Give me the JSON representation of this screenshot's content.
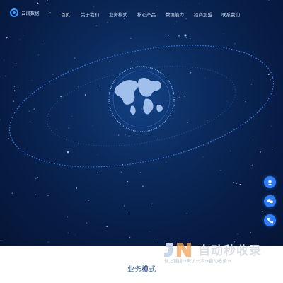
{
  "brand": {
    "name": "云阔数据"
  },
  "nav": {
    "items": [
      {
        "label": "首页",
        "active": true
      },
      {
        "label": "关于我们",
        "active": false
      },
      {
        "label": "业务模式",
        "active": false
      },
      {
        "label": "核心产品",
        "active": false
      },
      {
        "label": "数据能力",
        "active": false
      },
      {
        "label": "招商加盟",
        "active": false
      },
      {
        "label": "联系我们",
        "active": false
      }
    ]
  },
  "side_tools": [
    {
      "icon": "customer-service-icon"
    },
    {
      "icon": "wechat-icon"
    },
    {
      "icon": "phone-icon"
    }
  ],
  "section": {
    "title": "业务模式"
  },
  "watermark": {
    "title": "自动秒收录",
    "subtitle": "做上链接→来访一次→自动收录→"
  },
  "colors": {
    "accent": "#2f7df6",
    "hero_dark": "#061536",
    "hero_mid": "#0b2a5c"
  }
}
